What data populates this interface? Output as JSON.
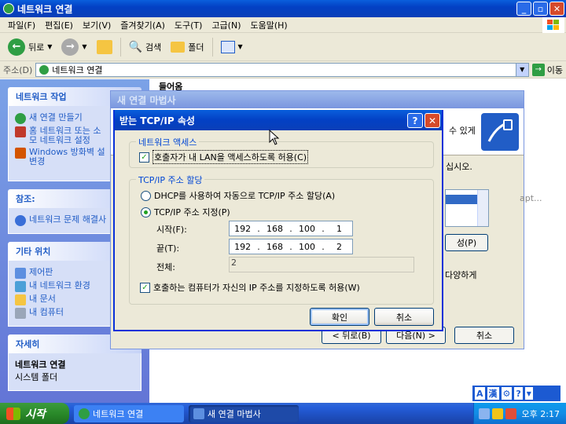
{
  "explorer": {
    "title": "네트워크 연결",
    "menu": [
      "파일(F)",
      "편집(E)",
      "보기(V)",
      "즐겨찾기(A)",
      "도구(T)",
      "고급(N)",
      "도움말(H)"
    ],
    "toolbar": {
      "back_label": "뒤로",
      "search_label": "검색",
      "folder_label": "폴더"
    },
    "address": {
      "label": "주소(D)",
      "value": "네트워크 연결",
      "go_label": "이동"
    },
    "content": {
      "fragment_top": "들어옴"
    }
  },
  "taskpane": {
    "network_tasks": {
      "header": "네트워크 작업",
      "items": [
        {
          "label": "새 연결 만들기"
        },
        {
          "label": "홈 네트워크 또는 소\n모 네트워크 설정"
        },
        {
          "label": "Windows 방화벽 설\n변경"
        }
      ]
    },
    "see_also": {
      "header": "참조:",
      "items": [
        {
          "label": "네트워크 문제 해결사"
        }
      ]
    },
    "other_places": {
      "header": "기타 위치",
      "items": [
        {
          "label": "제어판"
        },
        {
          "label": "내 네트워크 환경"
        },
        {
          "label": "내 문서"
        },
        {
          "label": "내 컴퓨터"
        }
      ]
    },
    "details": {
      "header": "자세히",
      "name": "네트워크 연결",
      "type": "시스템 폴더"
    }
  },
  "wizard": {
    "title": "새 연결 마법사",
    "fragments": {
      "can_text": "수 있게",
      "select_text": "십시오.",
      "item_text": "apt...",
      "multi_text": "다양하게"
    },
    "buttons": {
      "properties": "성(P)",
      "back": "< 뒤로(B)",
      "next": "다음(N) >",
      "cancel": "취소"
    }
  },
  "tcpip": {
    "title": "받는 TCP/IP 속성",
    "network_access": {
      "group": "네트워크 액세스",
      "allow_caller": "호출자가 내 LAN을 액세스하도록 허용(C)",
      "allow_caller_checked": true
    },
    "address_assign": {
      "group": "TCP/IP 주소 할당",
      "dhcp_label": "DHCP를 사용하여 자동으로 TCP/IP 주소 할당(A)",
      "specify_label": "TCP/IP 주소 지정(P)",
      "selected": "specify",
      "start_label": "시작(F):",
      "start_ip": [
        "192",
        "168",
        "100",
        "1"
      ],
      "end_label": "끝(T):",
      "end_ip": [
        "192",
        "168",
        "100",
        "2"
      ],
      "total_label": "전체:",
      "total_value": "2"
    },
    "allow_own_ip": "호출하는 컴퓨터가 자신의 IP 주소를 지정하도록 허용(W)",
    "allow_own_ip_checked": true,
    "ok": "확인",
    "cancel": "취소"
  },
  "langbar": {
    "mode": "A",
    "hanja": "漢"
  },
  "taskbar": {
    "start": "시작",
    "tasks": [
      {
        "label": "네트워크 연결"
      },
      {
        "label": "새 연결 마법사"
      }
    ],
    "clock": "오후 2:17"
  }
}
